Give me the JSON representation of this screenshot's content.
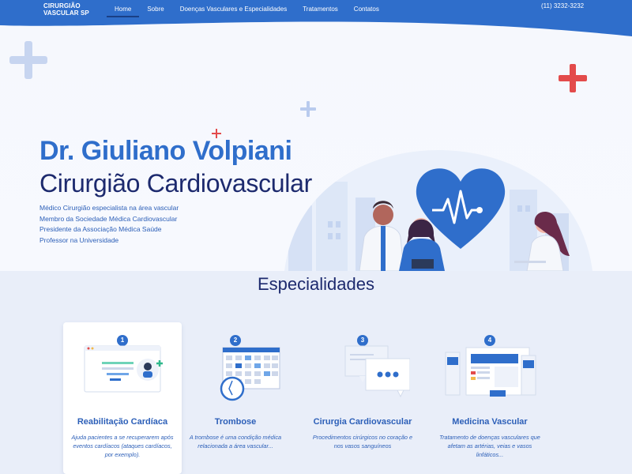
{
  "header": {
    "logo_line1": "CIRURGIÃO",
    "logo_line2": "VASCULAR SP",
    "nav": [
      {
        "label": "Home",
        "active": true
      },
      {
        "label": "Sobre"
      },
      {
        "label": "Doenças Vasculares e Especialidades"
      },
      {
        "label": "Tratamentos"
      },
      {
        "label": "Contatos"
      }
    ],
    "phone": "(11) 3232-3232",
    "color": "#2f6ecb"
  },
  "hero": {
    "name": "Dr. Giuliano Volpiani",
    "role": "Cirurgião Cardiovascular",
    "bio": [
      "Médico Cirurgião especialista na área vascular",
      "Membro da Sociedade Médica Cardiovascular",
      "Presidente da Associação Médica Saúde",
      "Professor na Universidade"
    ],
    "icons": [
      "plus-icon",
      "heart-icon",
      "doctors-illustration"
    ]
  },
  "specialties": {
    "title": "Especialidades",
    "cards": [
      {
        "num": "1",
        "title": "Reabilitação Cardíaca",
        "desc": "Ajuda pacientes a se recuperarem após eventos cardíacos (ataques cardíacos, por exemplo)."
      },
      {
        "num": "2",
        "title": "Trombose",
        "desc": "A trombose é uma condição médica relacionada a área vascular..."
      },
      {
        "num": "3",
        "title": "Cirurgia Cardiovascular",
        "desc": "Procedimentos cirúrgicos no coração e nos vasos sanguíneos"
      },
      {
        "num": "4",
        "title": "Medicina Vascular",
        "desc": "Tratamento de doenças vasculares que afetam as artérias, veias e vasos linfáticos..."
      }
    ]
  }
}
